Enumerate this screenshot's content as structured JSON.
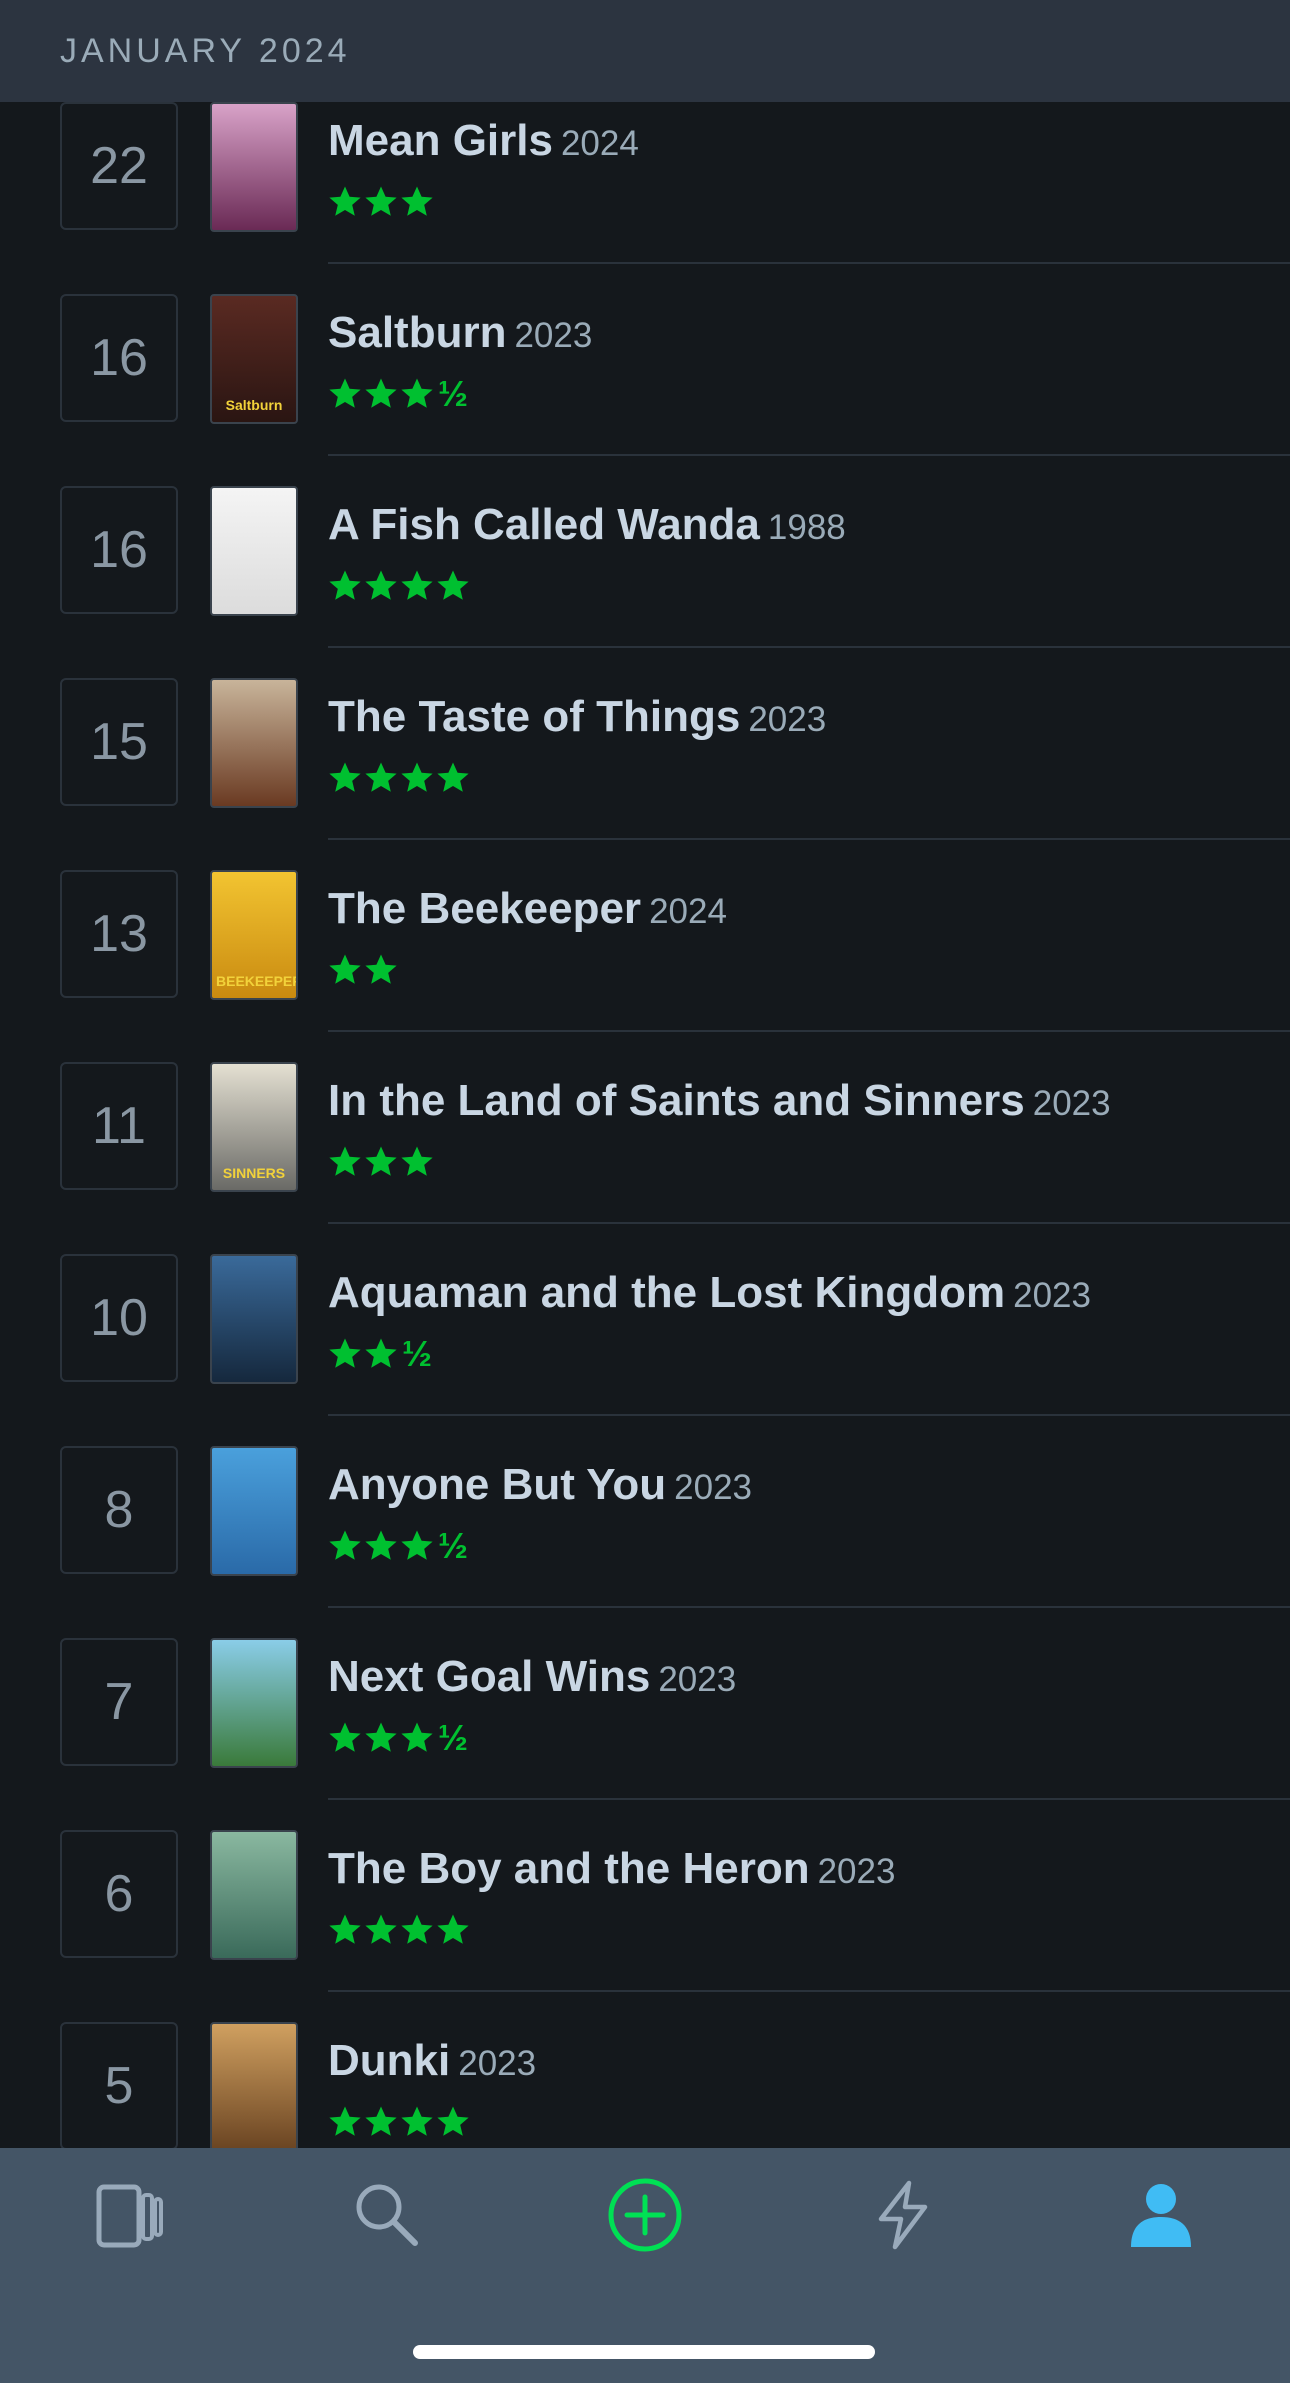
{
  "header": {
    "month": "JANUARY 2024"
  },
  "entries": [
    {
      "day": "22",
      "title": "Mean Girls",
      "year": "2024",
      "stars": 3,
      "half": "",
      "poster_colors": [
        "#d8a2c8",
        "#6a2a55"
      ],
      "poster_text": ""
    },
    {
      "day": "16",
      "title": "Saltburn",
      "year": "2023",
      "stars": 3,
      "half": "½",
      "poster_colors": [
        "#5a2a22",
        "#2a1512"
      ],
      "poster_text": "Saltburn"
    },
    {
      "day": "16",
      "title": "A Fish Called Wanda",
      "year": "1988",
      "stars": 4,
      "half": "",
      "poster_colors": [
        "#f4f4f4",
        "#dcdcdc"
      ],
      "poster_text": ""
    },
    {
      "day": "15",
      "title": "The Taste of Things",
      "year": "2023",
      "stars": 4,
      "half": "",
      "poster_colors": [
        "#c8b49a",
        "#6a3a22"
      ],
      "poster_text": ""
    },
    {
      "day": "13",
      "title": "The Beekeeper",
      "year": "2024",
      "stars": 2,
      "half": "",
      "poster_colors": [
        "#f2c431",
        "#c98a10"
      ],
      "poster_text": "BEEKEEPER"
    },
    {
      "day": "11",
      "title": "In the Land of Saints and Sinners",
      "year": "2023",
      "stars": 3,
      "half": "",
      "poster_colors": [
        "#e4e0d2",
        "#6a6a66"
      ],
      "poster_text": "SINNERS"
    },
    {
      "day": "10",
      "title": "Aquaman and the Lost Kingdom",
      "year": "2023",
      "stars": 2,
      "half": "½",
      "poster_colors": [
        "#3a6a9a",
        "#15283d"
      ],
      "poster_text": ""
    },
    {
      "day": "8",
      "title": "Anyone But You",
      "year": "2023",
      "stars": 3,
      "half": "½",
      "poster_colors": [
        "#4aa0dc",
        "#2a6aa8"
      ],
      "poster_text": ""
    },
    {
      "day": "7",
      "title": "Next Goal Wins",
      "year": "2023",
      "stars": 3,
      "half": "½",
      "poster_colors": [
        "#8acde8",
        "#3a7a3a"
      ],
      "poster_text": ""
    },
    {
      "day": "6",
      "title": "The Boy and the Heron",
      "year": "2023",
      "stars": 4,
      "half": "",
      "poster_colors": [
        "#8ab8a0",
        "#3a6a5a"
      ],
      "poster_text": ""
    },
    {
      "day": "5",
      "title": "Dunki",
      "year": "2023",
      "stars": 4,
      "half": "",
      "poster_colors": [
        "#d0a060",
        "#6a4422"
      ],
      "poster_text": ""
    }
  ],
  "tabbar": {
    "items": [
      {
        "name": "tab-films",
        "icon": "films-icon"
      },
      {
        "name": "tab-search",
        "icon": "search-icon"
      },
      {
        "name": "tab-add",
        "icon": "add-icon"
      },
      {
        "name": "tab-activity",
        "icon": "lightning-icon"
      },
      {
        "name": "tab-profile",
        "icon": "profile-icon"
      }
    ]
  },
  "colors": {
    "star_green": "#00c030",
    "active_blue": "#40bcf4",
    "add_green": "#00e054",
    "icon_gray": "#99aabb"
  }
}
